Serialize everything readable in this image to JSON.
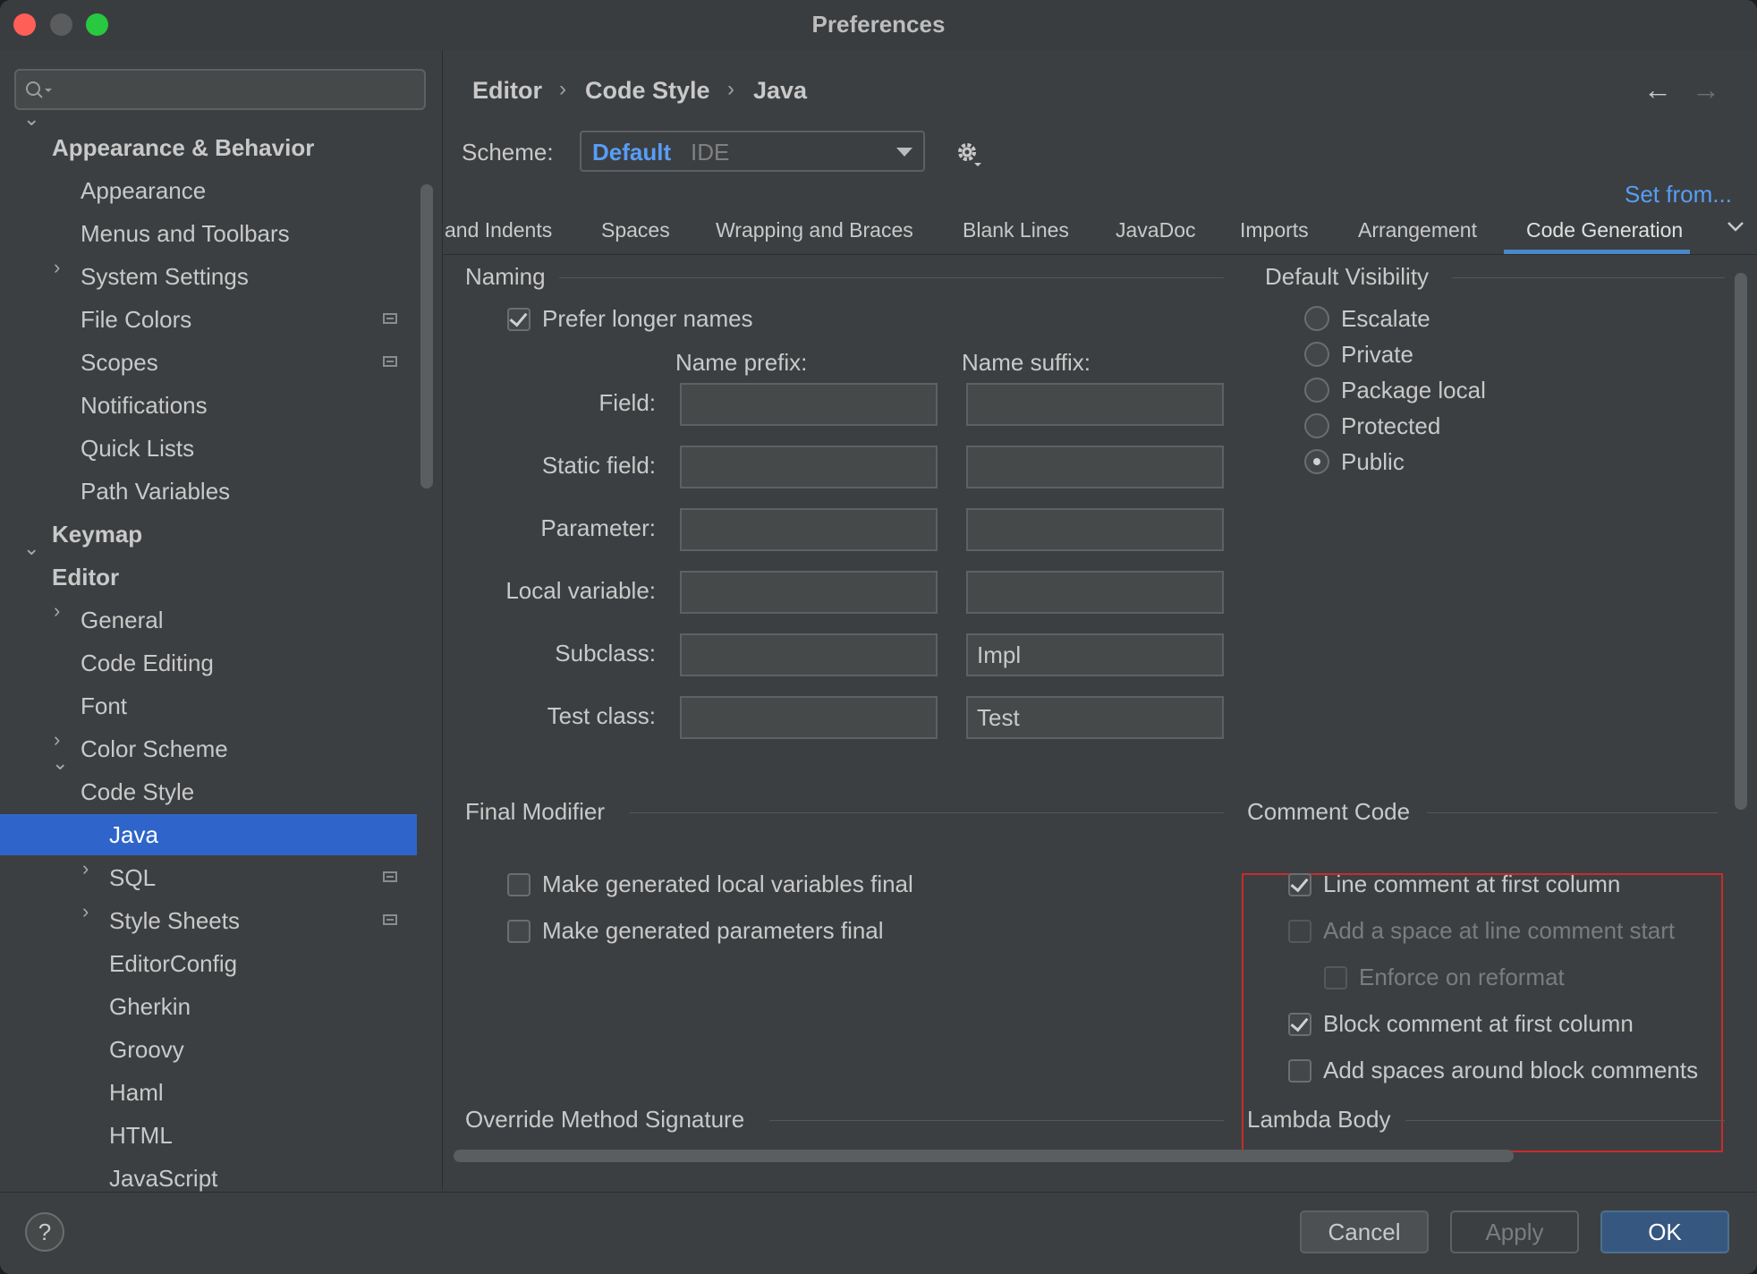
{
  "window": {
    "title": "Preferences"
  },
  "search": {
    "placeholder": ""
  },
  "sidebar": {
    "items": [
      {
        "label": "Appearance & Behavior"
      },
      {
        "label": "Appearance"
      },
      {
        "label": "Menus and Toolbars"
      },
      {
        "label": "System Settings"
      },
      {
        "label": "File Colors"
      },
      {
        "label": "Scopes"
      },
      {
        "label": "Notifications"
      },
      {
        "label": "Quick Lists"
      },
      {
        "label": "Path Variables"
      },
      {
        "label": "Keymap"
      },
      {
        "label": "Editor"
      },
      {
        "label": "General"
      },
      {
        "label": "Code Editing"
      },
      {
        "label": "Font"
      },
      {
        "label": "Color Scheme"
      },
      {
        "label": "Code Style"
      },
      {
        "label": "Java"
      },
      {
        "label": "SQL"
      },
      {
        "label": "Style Sheets"
      },
      {
        "label": "EditorConfig"
      },
      {
        "label": "Gherkin"
      },
      {
        "label": "Groovy"
      },
      {
        "label": "Haml"
      },
      {
        "label": "HTML"
      },
      {
        "label": "JavaScript"
      }
    ],
    "selected": "Java"
  },
  "breadcrumb": {
    "items": [
      "Editor",
      "Code Style",
      "Java"
    ],
    "separator": "›"
  },
  "nav": {
    "back": "←",
    "forward": "→"
  },
  "scheme": {
    "label": "Scheme:",
    "name": "Default",
    "type": "IDE"
  },
  "set_from": "Set from...",
  "tabs": {
    "items": [
      "and Indents",
      "Spaces",
      "Wrapping and Braces",
      "Blank Lines",
      "JavaDoc",
      "Imports",
      "Arrangement",
      "Code Generation"
    ],
    "active": "Code Generation"
  },
  "naming": {
    "title": "Naming",
    "prefer_longer": {
      "label": "Prefer longer names",
      "checked": true
    },
    "prefix_header": "Name prefix:",
    "suffix_header": "Name suffix:",
    "rows": [
      {
        "label": "Field:",
        "prefix": "",
        "suffix": ""
      },
      {
        "label": "Static field:",
        "prefix": "",
        "suffix": ""
      },
      {
        "label": "Parameter:",
        "prefix": "",
        "suffix": ""
      },
      {
        "label": "Local variable:",
        "prefix": "",
        "suffix": ""
      },
      {
        "label": "Subclass:",
        "prefix": "",
        "suffix": "Impl"
      },
      {
        "label": "Test class:",
        "prefix": "",
        "suffix": "Test"
      }
    ]
  },
  "default_visibility": {
    "title": "Default Visibility",
    "options": [
      "Escalate",
      "Private",
      "Package local",
      "Protected",
      "Public"
    ],
    "selected": "Public"
  },
  "final_modifier": {
    "title": "Final Modifier",
    "options": [
      {
        "label": "Make generated local variables final",
        "checked": false
      },
      {
        "label": "Make generated parameters final",
        "checked": false
      }
    ]
  },
  "comment_code": {
    "title": "Comment Code",
    "options": [
      {
        "label": "Line comment at first column",
        "checked": true,
        "enabled": true
      },
      {
        "label": "Add a space at line comment start",
        "checked": false,
        "enabled": false
      },
      {
        "label": "Enforce on reformat",
        "checked": false,
        "enabled": false
      },
      {
        "label": "Block comment at first column",
        "checked": true,
        "enabled": true
      },
      {
        "label": "Add spaces around block comments",
        "checked": false,
        "enabled": true
      }
    ]
  },
  "sections_below": {
    "override": "Override Method Signature",
    "lambda": "Lambda Body"
  },
  "footer": {
    "help": "?",
    "cancel": "Cancel",
    "apply": "Apply",
    "ok": "OK"
  },
  "colors": {
    "accent": "#2f65ca",
    "link": "#589df6",
    "highlight_border": "#c92b2b"
  }
}
